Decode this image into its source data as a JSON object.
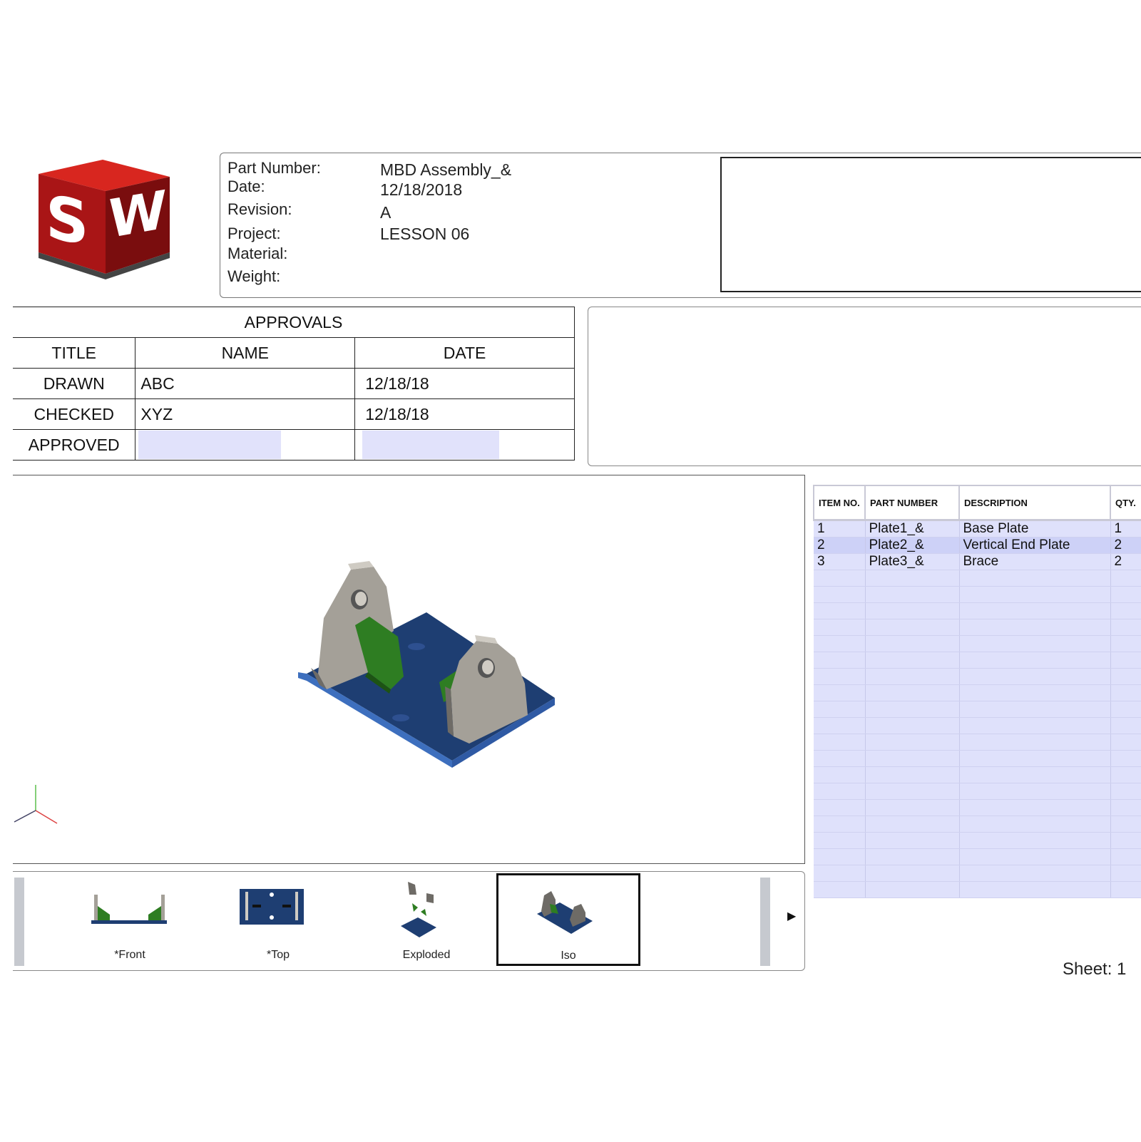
{
  "header": {
    "labels": {
      "part_number": "Part Number:",
      "date": "Date:",
      "revision": "Revision:",
      "project": "Project:",
      "material": "Material:",
      "weight": "Weight:"
    },
    "values": {
      "part_number": "MBD Assembly_&",
      "date": "12/18/2018",
      "revision": "A",
      "project": "LESSON 06",
      "material": "",
      "weight": ""
    }
  },
  "approvals": {
    "caption": "APPROVALS",
    "columns": [
      "TITLE",
      "NAME",
      "DATE"
    ],
    "rows": [
      {
        "title": "DRAWN",
        "name": "ABC",
        "date": "12/18/18"
      },
      {
        "title": "CHECKED",
        "name": "XYZ",
        "date": "12/18/18"
      },
      {
        "title": "APPROVED",
        "name": "",
        "date": ""
      }
    ]
  },
  "bom": {
    "columns": [
      "ITEM NO.",
      "PART NUMBER",
      "DESCRIPTION",
      "QTY."
    ],
    "rows": [
      {
        "item": "1",
        "part": "Plate1_&",
        "description": "Base Plate",
        "qty": "1"
      },
      {
        "item": "2",
        "part": "Plate2_&",
        "description": "Vertical End Plate",
        "qty": "2"
      },
      {
        "item": "3",
        "part": "Plate3_&",
        "description": "Brace",
        "qty": "2"
      }
    ]
  },
  "views": {
    "thumbnails": [
      {
        "label": "*Front"
      },
      {
        "label": "*Top"
      },
      {
        "label": "Exploded"
      },
      {
        "label": "Iso",
        "selected": true
      }
    ],
    "next_arrow": "▶"
  },
  "sheet": {
    "label": "Sheet: 1"
  },
  "colors": {
    "logo_red": "#b3191b",
    "base_plate_blue": "#1d3b6e",
    "vertical_plate_gray": "#a7a39b",
    "brace_green": "#2c7a1e",
    "bom_fill": "#dfe1fb",
    "approval_blank_fill": "#e1e2fb"
  }
}
